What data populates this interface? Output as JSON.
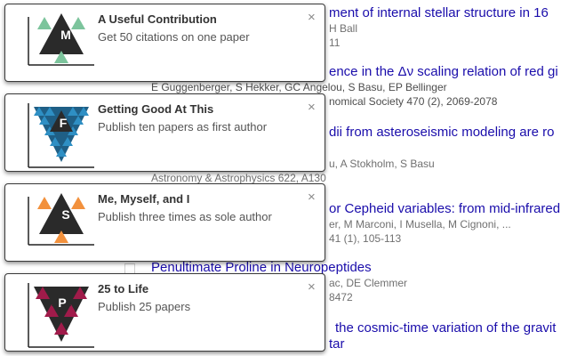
{
  "background": {
    "results": [
      {
        "title": "ment of internal stellar structure in 16",
        "lines": [
          "H Ball",
          "11"
        ]
      },
      {
        "title": "ence in the Δν scaling relation of red gi",
        "lines": [
          "E Guggenberger, S Hekker, GC Angelou, S Basu, EP Bellinger",
          "nomical Society 470 (2), 2069-2078"
        ]
      },
      {
        "title": "dii from asteroseismic modeling are ro",
        "lines": [
          "u, A Stokholm, S Basu",
          "Astronomy & Astrophysics 622, A130"
        ]
      },
      {
        "title": "or Cepheid variables: from mid-infrared",
        "lines": [
          "er, M Marconi, I Musella, M Cignoni, ...",
          "41 (1), 105-113"
        ]
      },
      {
        "title": "Penultimate Proline in Neuropeptides",
        "lines": [
          "ac, DE Clemmer",
          "8472"
        ]
      },
      {
        "title": "the cosmic-time variation of the gravit",
        "title2": "tar"
      }
    ]
  },
  "notifications": [
    {
      "letter": "M",
      "title": "A Useful Contribution",
      "message": "Get 50 citations on one paper",
      "color": "#7cc49c"
    },
    {
      "letter": "F",
      "title": "Getting Good At This",
      "message": "Publish ten papers as first author",
      "color": "#2e8fc4"
    },
    {
      "letter": "S",
      "title": "Me, Myself, and I",
      "message": "Publish three times as sole author",
      "color": "#f2913d"
    },
    {
      "letter": "P",
      "title": "25 to Life",
      "message": "Publish 25 papers",
      "color": "#a01b4a"
    }
  ],
  "close_glyph": "×"
}
